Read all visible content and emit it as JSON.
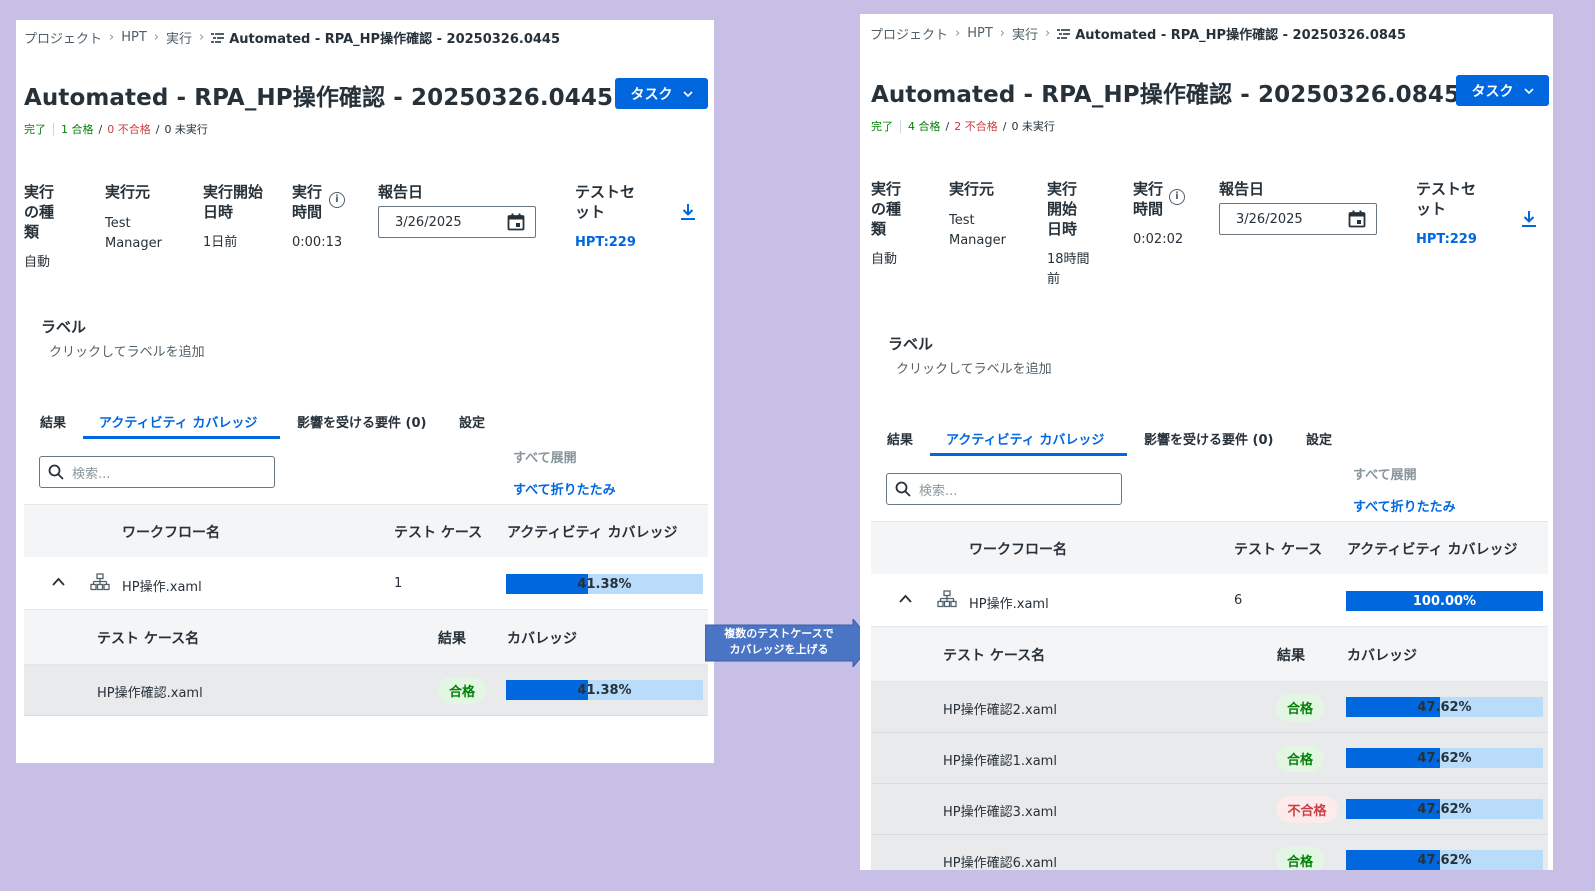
{
  "callout": {
    "line1": "複数のテストケースで",
    "line2": "カバレッジを上げる"
  },
  "left": {
    "breadcrumb": {
      "project": "プロジェクト",
      "hpt": "HPT",
      "run": "実行",
      "current": "Automated - RPA_HP操作確認 - 20250326.0445"
    },
    "title": "Automated - RPA_HP操作確認 - 20250326.0445",
    "task_button": "タスク",
    "status": {
      "done": "完了",
      "passed": "1 合格",
      "failed": "0 不合格",
      "not_run": "0 未実行",
      "sep": "/"
    },
    "meta": {
      "type_label": "実行の種類",
      "type_value": "自動",
      "source_label": "実行元",
      "source_value": "Test Manager",
      "start_label": "実行開始日時",
      "start_value": "1日前",
      "duration_label": "実行時間",
      "duration_value": "0:00:13",
      "report_label": "報告日",
      "report_value": "3/26/2025",
      "testset_label": "テストセット",
      "testset_value": "HPT:229"
    },
    "labels": {
      "heading": "ラベル",
      "hint": "クリックしてラベルを追加"
    },
    "tabs": [
      "結果",
      "アクティビティ カバレッジ",
      "影響を受ける要件 (0)",
      "設定"
    ],
    "search": {
      "placeholder": "検索..."
    },
    "expand_all": "すべて展開",
    "collapse_all": "すべて折りたたみ",
    "table": {
      "headers": [
        "ワークフロー名",
        "テスト ケース",
        "アクティビティ カバレッジ"
      ],
      "workflow": {
        "name": "HP操作.xaml",
        "cases": "1",
        "coverage": 0.4138,
        "coverage_label": "41.38%"
      },
      "sub_headers": [
        "テスト ケース名",
        "結果",
        "カバレッジ"
      ],
      "rows": [
        {
          "name": "HP操作確認.xaml",
          "result": "合格",
          "status": "pass",
          "coverage": 0.4138,
          "coverage_label": "41.38%"
        }
      ]
    }
  },
  "right": {
    "breadcrumb": {
      "project": "プロジェクト",
      "hpt": "HPT",
      "run": "実行",
      "current": "Automated - RPA_HP操作確認 - 20250326.0845"
    },
    "title": "Automated - RPA_HP操作確認 - 20250326.0845",
    "task_button": "タスク",
    "status": {
      "done": "完了",
      "passed": "4 合格",
      "failed": "2 不合格",
      "not_run": "0 未実行",
      "sep": "/"
    },
    "meta": {
      "type_label": "実行の種類",
      "type_value": "自動",
      "source_label": "実行元",
      "source_value": "Test Manager",
      "start_label": "実行開始日時",
      "start_value": "18時間前",
      "duration_label": "実行時間",
      "duration_value": "0:02:02",
      "report_label": "報告日",
      "report_value": "3/26/2025",
      "testset_label": "テストセット",
      "testset_value": "HPT:229"
    },
    "labels": {
      "heading": "ラベル",
      "hint": "クリックしてラベルを追加"
    },
    "tabs": [
      "結果",
      "アクティビティ カバレッジ",
      "影響を受ける要件 (0)",
      "設定"
    ],
    "search": {
      "placeholder": "検索..."
    },
    "expand_all": "すべて展開",
    "collapse_all": "すべて折りたたみ",
    "table": {
      "headers": [
        "ワークフロー名",
        "テスト ケース",
        "アクティビティ カバレッジ"
      ],
      "workflow": {
        "name": "HP操作.xaml",
        "cases": "6",
        "coverage": 1.0,
        "coverage_label": "100.00%"
      },
      "sub_headers": [
        "テスト ケース名",
        "結果",
        "カバレッジ"
      ],
      "rows": [
        {
          "name": "HP操作確認2.xaml",
          "result": "合格",
          "status": "pass",
          "coverage": 0.4762,
          "coverage_label": "47.62%"
        },
        {
          "name": "HP操作確認1.xaml",
          "result": "合格",
          "status": "pass",
          "coverage": 0.4762,
          "coverage_label": "47.62%"
        },
        {
          "name": "HP操作確認3.xaml",
          "result": "不合格",
          "status": "fail",
          "coverage": 0.4762,
          "coverage_label": "47.62%"
        },
        {
          "name": "HP操作確認6.xaml",
          "result": "合格",
          "status": "pass",
          "coverage": 0.4762,
          "coverage_label": "47.62%"
        }
      ]
    },
    "colors": {
      "accent": "#0067df",
      "pass": "#038108",
      "fail": "#cc3d45"
    }
  }
}
